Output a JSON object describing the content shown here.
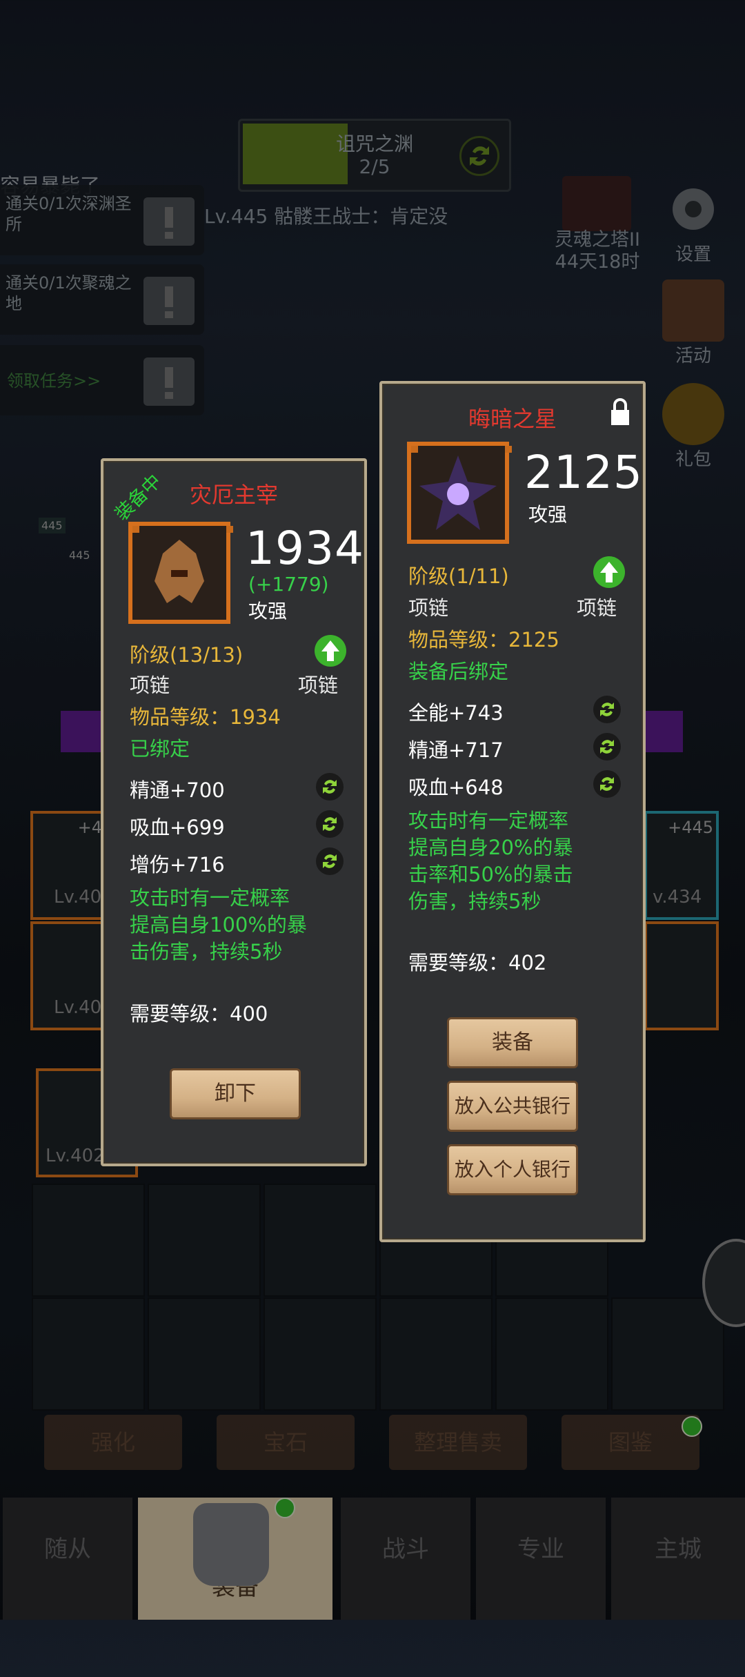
{
  "quest": {
    "title": "诅咒之渊",
    "progress": "2/5"
  },
  "boss_line": "Lv.445 骷髅王战士：肯定没",
  "tasks": {
    "overtitle": "容易暴毙了",
    "items": [
      "通关0/1次深渊圣所",
      "通关0/1次聚魂之地"
    ],
    "link": "领取任务>>"
  },
  "tower": {
    "name": "灵魂之塔II",
    "time": "44天18时"
  },
  "side_icons": {
    "settings": "设置",
    "activity": "活动",
    "gift": "礼包"
  },
  "background": {
    "level_labels": [
      "445",
      "445"
    ],
    "left_items": [
      {
        "badge": "+4",
        "level": "Lv.40"
      },
      {
        "level": "Lv.40"
      }
    ],
    "right_items": [
      {
        "badge": "+445",
        "level": "v.434"
      }
    ],
    "inv_level": "Lv.402"
  },
  "equipped": {
    "status_tag": "装备中",
    "name": "灾厄主宰",
    "power": "1934",
    "power_diff": "(+1779)",
    "power_type": "攻强",
    "tier": "阶级(13/13)",
    "slot_left": "项链",
    "slot_right": "项链",
    "item_level": "物品等级：1934",
    "bind_status": "已绑定",
    "stats": [
      "精通+700",
      "吸血+699",
      "增伤+716"
    ],
    "effect": [
      "攻击时有一定概率",
      "提高自身100%的暴",
      "击伤害，持续5秒"
    ],
    "req_level": "需要等级：400",
    "action": "卸下"
  },
  "candidate": {
    "name": "晦暗之星",
    "power": "2125",
    "power_type": "攻强",
    "tier": "阶级(1/11)",
    "slot_left": "项链",
    "slot_right": "项链",
    "item_level": "物品等级：2125",
    "bind_status": "装备后绑定",
    "stats": [
      "全能+743",
      "精通+717",
      "吸血+648"
    ],
    "effect": [
      "攻击时有一定概率",
      "提高自身20%的暴",
      "击率和50%的暴击",
      "伤害，持续5秒"
    ],
    "req_level": "需要等级：402",
    "actions": [
      "装备",
      "放入公共银行",
      "放入个人银行"
    ]
  },
  "subtabs": [
    "强化",
    "宝石",
    "整理售卖",
    "图鉴"
  ],
  "nav": [
    "随从",
    "装备",
    "战斗",
    "专业",
    "主城"
  ],
  "colors": {
    "title_red": "#e4392f",
    "stat_green": "#37d14a",
    "gold": "#e8b73a",
    "frame_orange": "#d6701d"
  }
}
